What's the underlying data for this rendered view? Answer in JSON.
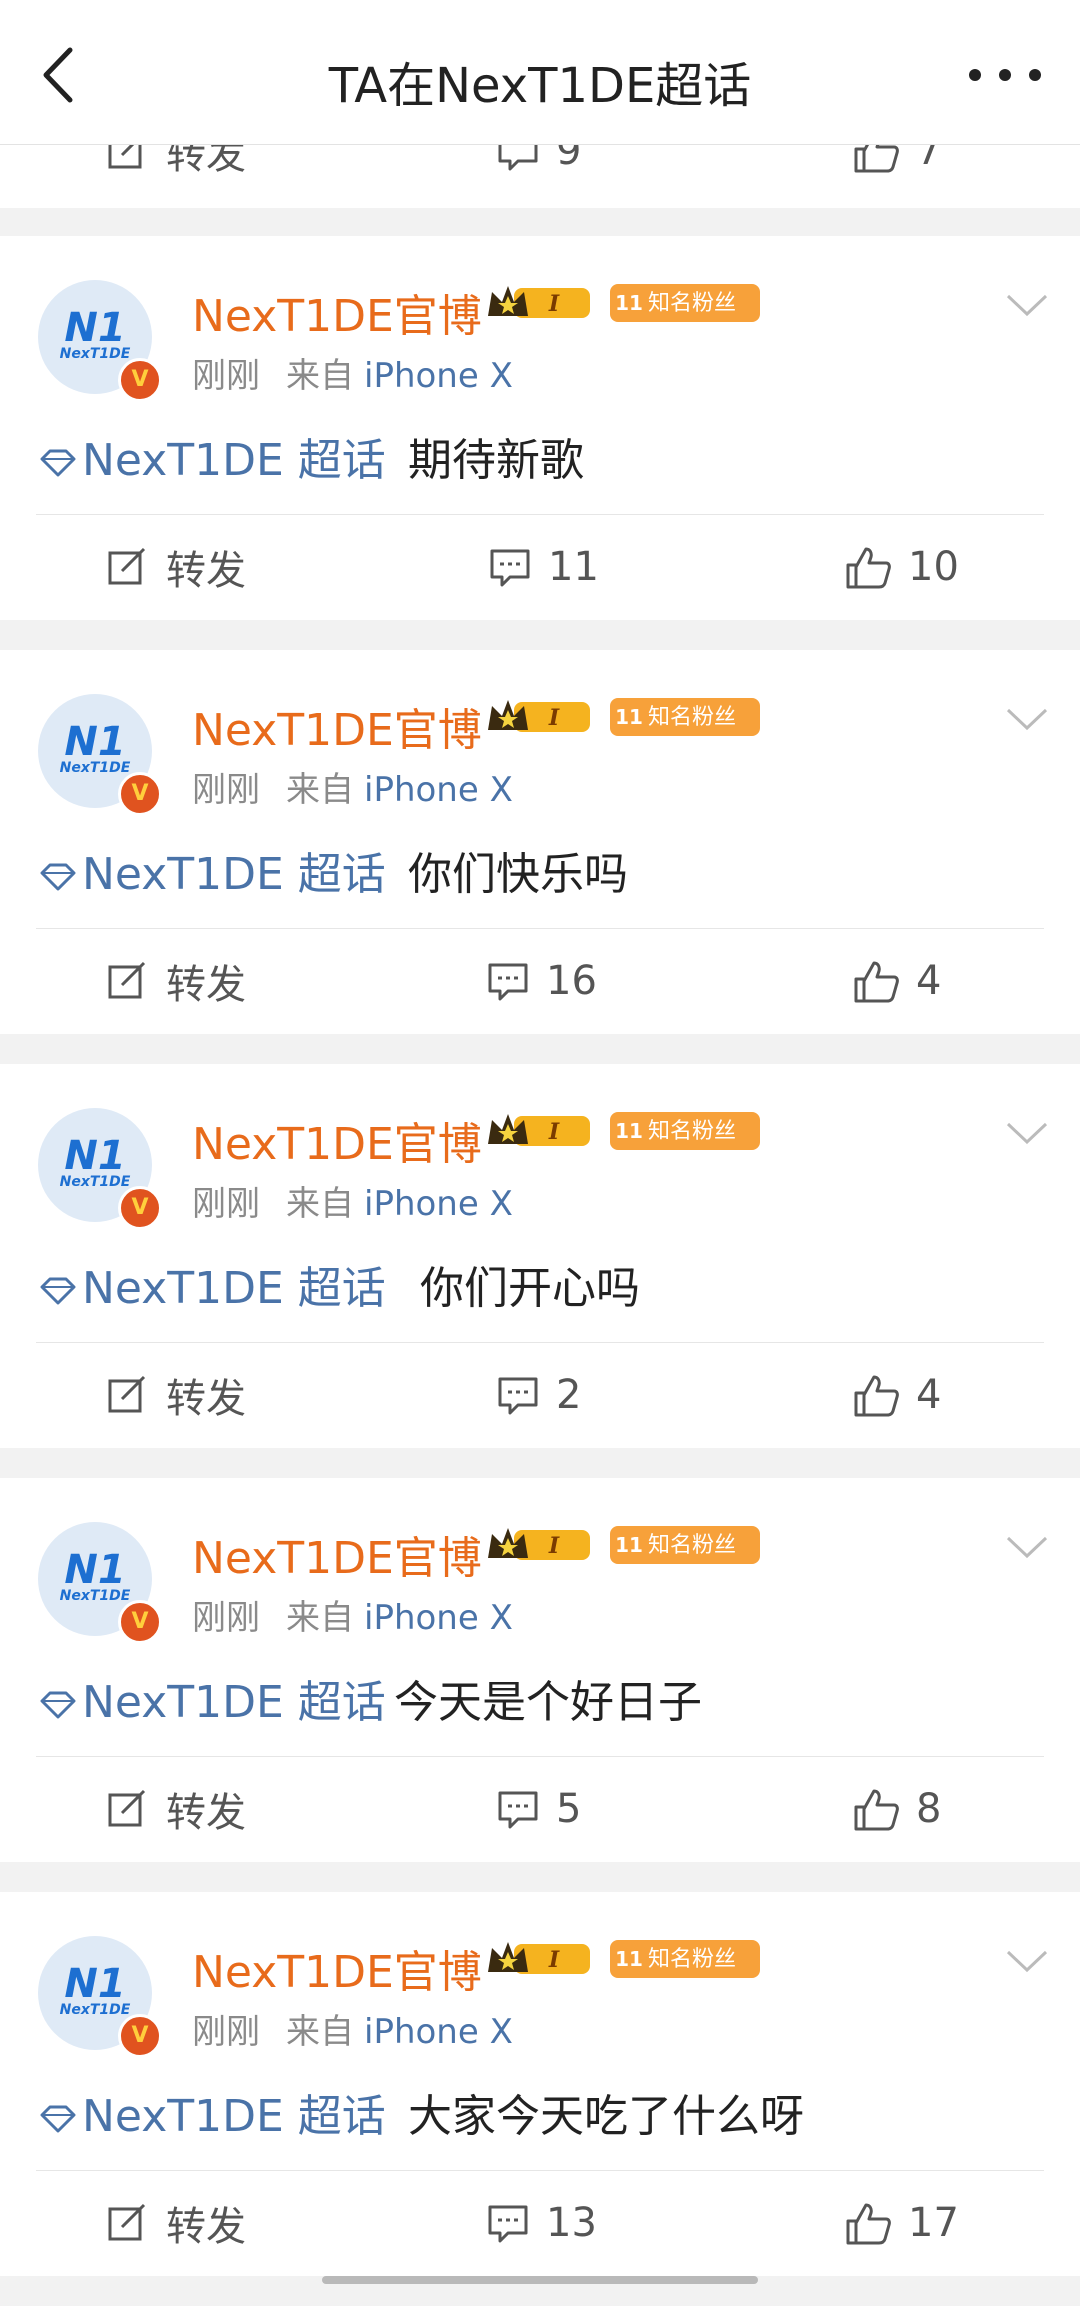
{
  "header": {
    "title": "TA在NexT1DE超话"
  },
  "partial_post": {
    "repost_label": "转发",
    "comments": "9",
    "likes": "7"
  },
  "posts": [
    {
      "author": "NexT1DE官博",
      "crown_level": "I",
      "fan_level": "11",
      "fan_badge": "知名粉丝",
      "time": "刚刚",
      "source_label": "来自",
      "device": "iPhone X",
      "topic": "NexT1DE 超话",
      "text": "期待新歌",
      "repost_label": "转发",
      "comments": "11",
      "likes": "10"
    },
    {
      "author": "NexT1DE官博",
      "crown_level": "I",
      "fan_level": "11",
      "fan_badge": "知名粉丝",
      "time": "刚刚",
      "source_label": "来自",
      "device": "iPhone X",
      "topic": "NexT1DE 超话",
      "text": "你们快乐吗",
      "repost_label": "转发",
      "comments": "16",
      "likes": "4"
    },
    {
      "author": "NexT1DE官博",
      "crown_level": "I",
      "fan_level": "11",
      "fan_badge": "知名粉丝",
      "time": "刚刚",
      "source_label": "来自",
      "device": "iPhone X",
      "topic": "NexT1DE 超话",
      "text": "你们开心吗",
      "repost_label": "转发",
      "comments": "2",
      "likes": "4"
    },
    {
      "author": "NexT1DE官博",
      "crown_level": "I",
      "fan_level": "11",
      "fan_badge": "知名粉丝",
      "time": "刚刚",
      "source_label": "来自",
      "device": "iPhone X",
      "topic": "NexT1DE 超话",
      "text": "今天是个好日子",
      "repost_label": "转发",
      "comments": "5",
      "likes": "8"
    },
    {
      "author": "NexT1DE官博",
      "crown_level": "I",
      "fan_level": "11",
      "fan_badge": "知名粉丝",
      "time": "刚刚",
      "source_label": "来自",
      "device": "iPhone X",
      "topic": "NexT1DE 超话",
      "text": "大家今天吃了什么呀",
      "repost_label": "转发",
      "comments": "13",
      "likes": "17"
    }
  ],
  "avatar_logo": "N1",
  "avatar_logo_sub": "NexT1DE",
  "colors": {
    "author": "#e86b1b",
    "topic": "#4a73a8",
    "fan_badge": "#f7a13a"
  }
}
